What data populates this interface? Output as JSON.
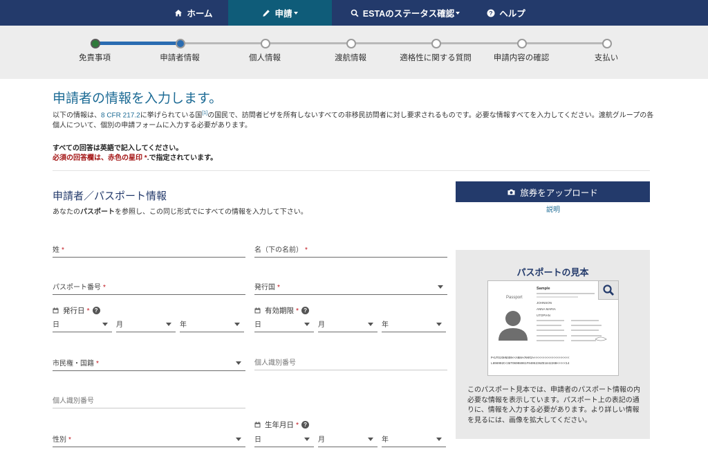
{
  "nav": {
    "home": "ホーム",
    "apply": "申請",
    "status": "ESTAのステータス確認",
    "help": "ヘルプ"
  },
  "steps": [
    {
      "label": "免責事項",
      "state": "done"
    },
    {
      "label": "申請者情報",
      "state": "current"
    },
    {
      "label": "個人情報",
      "state": "todo"
    },
    {
      "label": "渡航情報",
      "state": "todo"
    },
    {
      "label": "適格性に関する質問",
      "state": "todo"
    },
    {
      "label": "申請内容の確認",
      "state": "todo"
    },
    {
      "label": "支払い",
      "state": "todo"
    }
  ],
  "page": {
    "title": "申請者の情報を入力します。",
    "intro_a": "以下の情報は、",
    "intro_link": "8 CFR 217.2",
    "intro_b": "に挙げられている国",
    "intro_sup": "[1]",
    "intro_c": "の国民で、訪問者ビザを所有しないすべての非移民訪問者に対し要求されるものです。必要な情報すべてを入力してください。渡航グループの各個人について、個別の申請フォームに入力する必要があります。",
    "note_english": "すべての回答は英語で記入してください。",
    "note_required_a": "必須の回答欄は、赤色の星印 ",
    "note_required_star": "*",
    "note_required_b": ".で指定されています。"
  },
  "section": {
    "title": "申請者／パスポート情報",
    "sub_a": "あなたの",
    "sub_bold": "パスポート",
    "sub_b": "を参照し、この同じ形式でにすべての情報を入力して下さい。"
  },
  "upload": {
    "button": "旅券をアップロード",
    "explain": "説明"
  },
  "fields": {
    "surname": "姓",
    "given_name": "名（下の名前）",
    "passport_number": "パスポート番号",
    "issuing_country": "発行国",
    "issue_date": "発行日",
    "expiry_date": "有効期限",
    "day": "日",
    "month": "月",
    "year": "年",
    "citizenship": "市民権・国籍",
    "personal_id_1": "個人識別番号",
    "personal_id_2": "個人識別番号",
    "gender": "性別",
    "birth_date": "生年月日",
    "required_star": "*"
  },
  "passport_sample": {
    "title": "パスポートの見本",
    "description": "このパスポート見本では、申請者のパスポート情報の内必要な情報を表示しています。パスポート上の表記の通りに、情報を入力する必要があります。より詳しい情報を見るには、画像を拡大してください。",
    "img_passport": "Passport",
    "img_sample": "Sample",
    "img_name1": "JOHNSON",
    "img_name2": "ANNA MARIA",
    "img_nat": "UTOPIAN",
    "img_mrz1": "P<UTOJOHNSON<<ANNA<MARIA<<<<<<<<<<<<<<<<<<<<",
    "img_mrz2": "L898902C<3UTO6908061F9406236ZE184226B<<<<<14"
  },
  "colors": {
    "nav_bg": "#233a6b",
    "nav_active": "#0f5c79",
    "progress_done": "#2a6cb1",
    "title": "#1d6b95",
    "required": "#c0141c"
  }
}
